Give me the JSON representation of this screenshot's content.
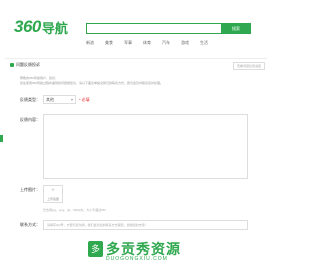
{
  "header": {
    "logo_num": "360",
    "logo_cn": "导航",
    "search_button": "搜索",
    "nav": [
      "新浪",
      "美食",
      "军事",
      "体育",
      "汽车",
      "游戏",
      "生活"
    ]
  },
  "panel": {
    "title": "问题反馈投诉",
    "link": "查看问题反馈进度",
    "intro_line1": "尊敬的360导航用户，您好：",
    "intro_line2": "您在使用360导航过程中遇到的问题或建议，请以下面表单提交我们的联系方式，我们会及时联系您并处理。",
    "type_label": "反馈类型：",
    "type_value": "其他",
    "type_required": "* 必填",
    "content_label": "反馈内容：",
    "upload_label": "上传图片：",
    "upload_plus": "+",
    "upload_text": "上传截图",
    "upload_hint": "仅支持jpg、png、gif，5M以内，大小不超过5M",
    "contact_label": "联系方式：",
    "contact_placeholder": "请填写QQ号，方便与您沟通，我们会对您的联系方式保密，谢谢您的支持！"
  },
  "watermark": {
    "logo": "多",
    "text": "多贡秀资源",
    "sub": "DUOGONGXIU.COM"
  }
}
